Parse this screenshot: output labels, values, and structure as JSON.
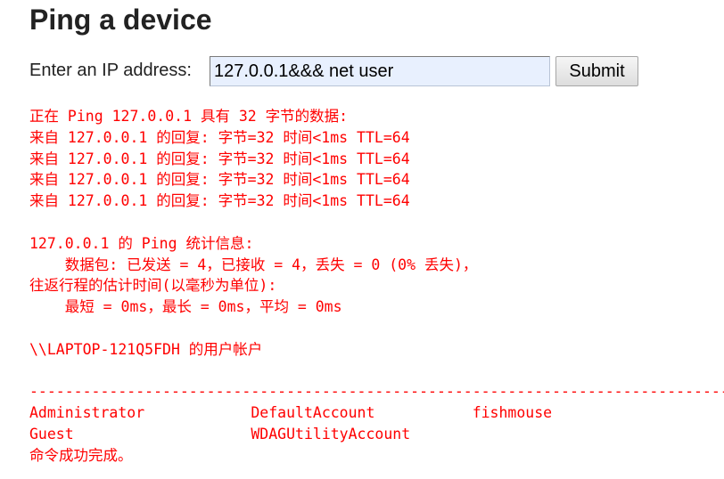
{
  "page": {
    "title": "Ping a device"
  },
  "form": {
    "label": "Enter an IP address:",
    "ip_value": "127.0.0.1&&& net user",
    "submit_label": "Submit"
  },
  "colors": {
    "output_text": "#ff0000",
    "input_background": "#e8f0fe"
  },
  "output": {
    "lines": [
      "正在 Ping 127.0.0.1 具有 32 字节的数据:",
      "来自 127.0.0.1 的回复: 字节=32 时间<1ms TTL=64",
      "来自 127.0.0.1 的回复: 字节=32 时间<1ms TTL=64",
      "来自 127.0.0.1 的回复: 字节=32 时间<1ms TTL=64",
      "来自 127.0.0.1 的回复: 字节=32 时间<1ms TTL=64",
      "",
      "127.0.0.1 的 Ping 统计信息:",
      "    数据包: 已发送 = 4，已接收 = 4，丢失 = 0 (0% 丢失)，",
      "往返行程的估计时间(以毫秒为单位):",
      "    最短 = 0ms，最长 = 0ms，平均 = 0ms",
      "",
      "\\\\LAPTOP-121Q5FDH 的用户帐户",
      "",
      "-------------------------------------------------------------------------------",
      "Administrator            DefaultAccount           fishmouse",
      "Guest                    WDAGUtilityAccount",
      "命令成功完成。"
    ]
  }
}
